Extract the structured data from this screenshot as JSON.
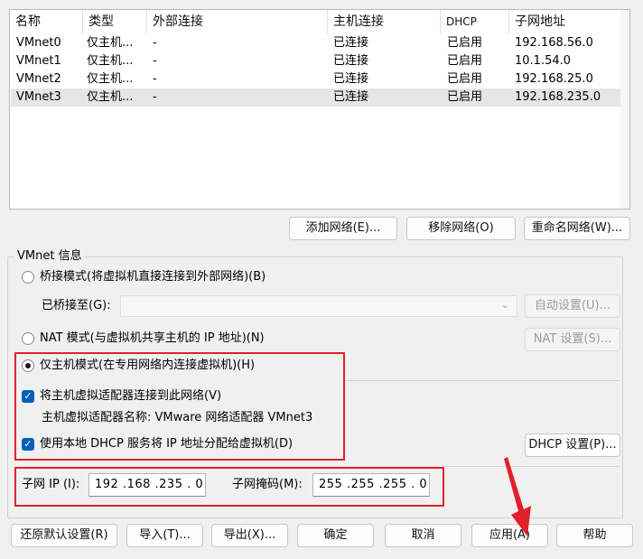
{
  "table": {
    "headers": [
      "名称",
      "类型",
      "外部连接",
      "主机连接",
      "DHCP",
      "子网地址"
    ],
    "rows": [
      {
        "name": "VMnet0",
        "type": "仅主机...",
        "external": "-",
        "host": "已连接",
        "dhcp": "已启用",
        "subnet": "192.168.56.0"
      },
      {
        "name": "VMnet1",
        "type": "仅主机...",
        "external": "-",
        "host": "已连接",
        "dhcp": "已启用",
        "subnet": "10.1.54.0"
      },
      {
        "name": "VMnet2",
        "type": "仅主机...",
        "external": "-",
        "host": "已连接",
        "dhcp": "已启用",
        "subnet": "192.168.25.0"
      },
      {
        "name": "VMnet3",
        "type": "仅主机...",
        "external": "-",
        "host": "已连接",
        "dhcp": "已启用",
        "subnet": "192.168.235.0"
      }
    ],
    "selected_row": 3
  },
  "net_buttons": {
    "add": "添加网络(E)...",
    "remove": "移除网络(O)",
    "rename": "重命名网络(W)..."
  },
  "group": {
    "title": "VMnet 信息",
    "bridge_radio": "桥接模式(将虚拟机直接连接到外部网络)(B)",
    "bridged_to_label": "已桥接至(G):",
    "auto_settings": "自动设置(U)...",
    "nat_radio": "NAT 模式(与虚拟机共享主机的 IP 地址)(N)",
    "nat_settings": "NAT 设置(S)...",
    "hostonly_radio": "仅主机模式(在专用网络内连接虚拟机)(H)",
    "connect_adapter": "将主机虚拟适配器连接到此网络(V)",
    "adapter_name": "主机虚拟适配器名称: VMware 网络适配器 VMnet3",
    "use_dhcp": "使用本地 DHCP 服务将 IP 地址分配给虚拟机(D)",
    "dhcp_settings": "DHCP 设置(P)...",
    "subnet_ip_label": "子网 IP (I):",
    "subnet_ip_value": "192 .168 .235 .  0",
    "subnet_mask_label": "子网掩码(M):",
    "subnet_mask_value": "255 .255 .255 .  0"
  },
  "bottom_buttons": {
    "restore": "还原默认设置(R)",
    "import": "导入(T)...",
    "export": "导出(X)...",
    "ok": "确定",
    "cancel": "取消",
    "apply": "应用(A)",
    "help": "帮助"
  },
  "colors": {
    "accent": "#005fb8",
    "annotation_red": "#e0212a",
    "selected_row": "#e6e6e6"
  }
}
